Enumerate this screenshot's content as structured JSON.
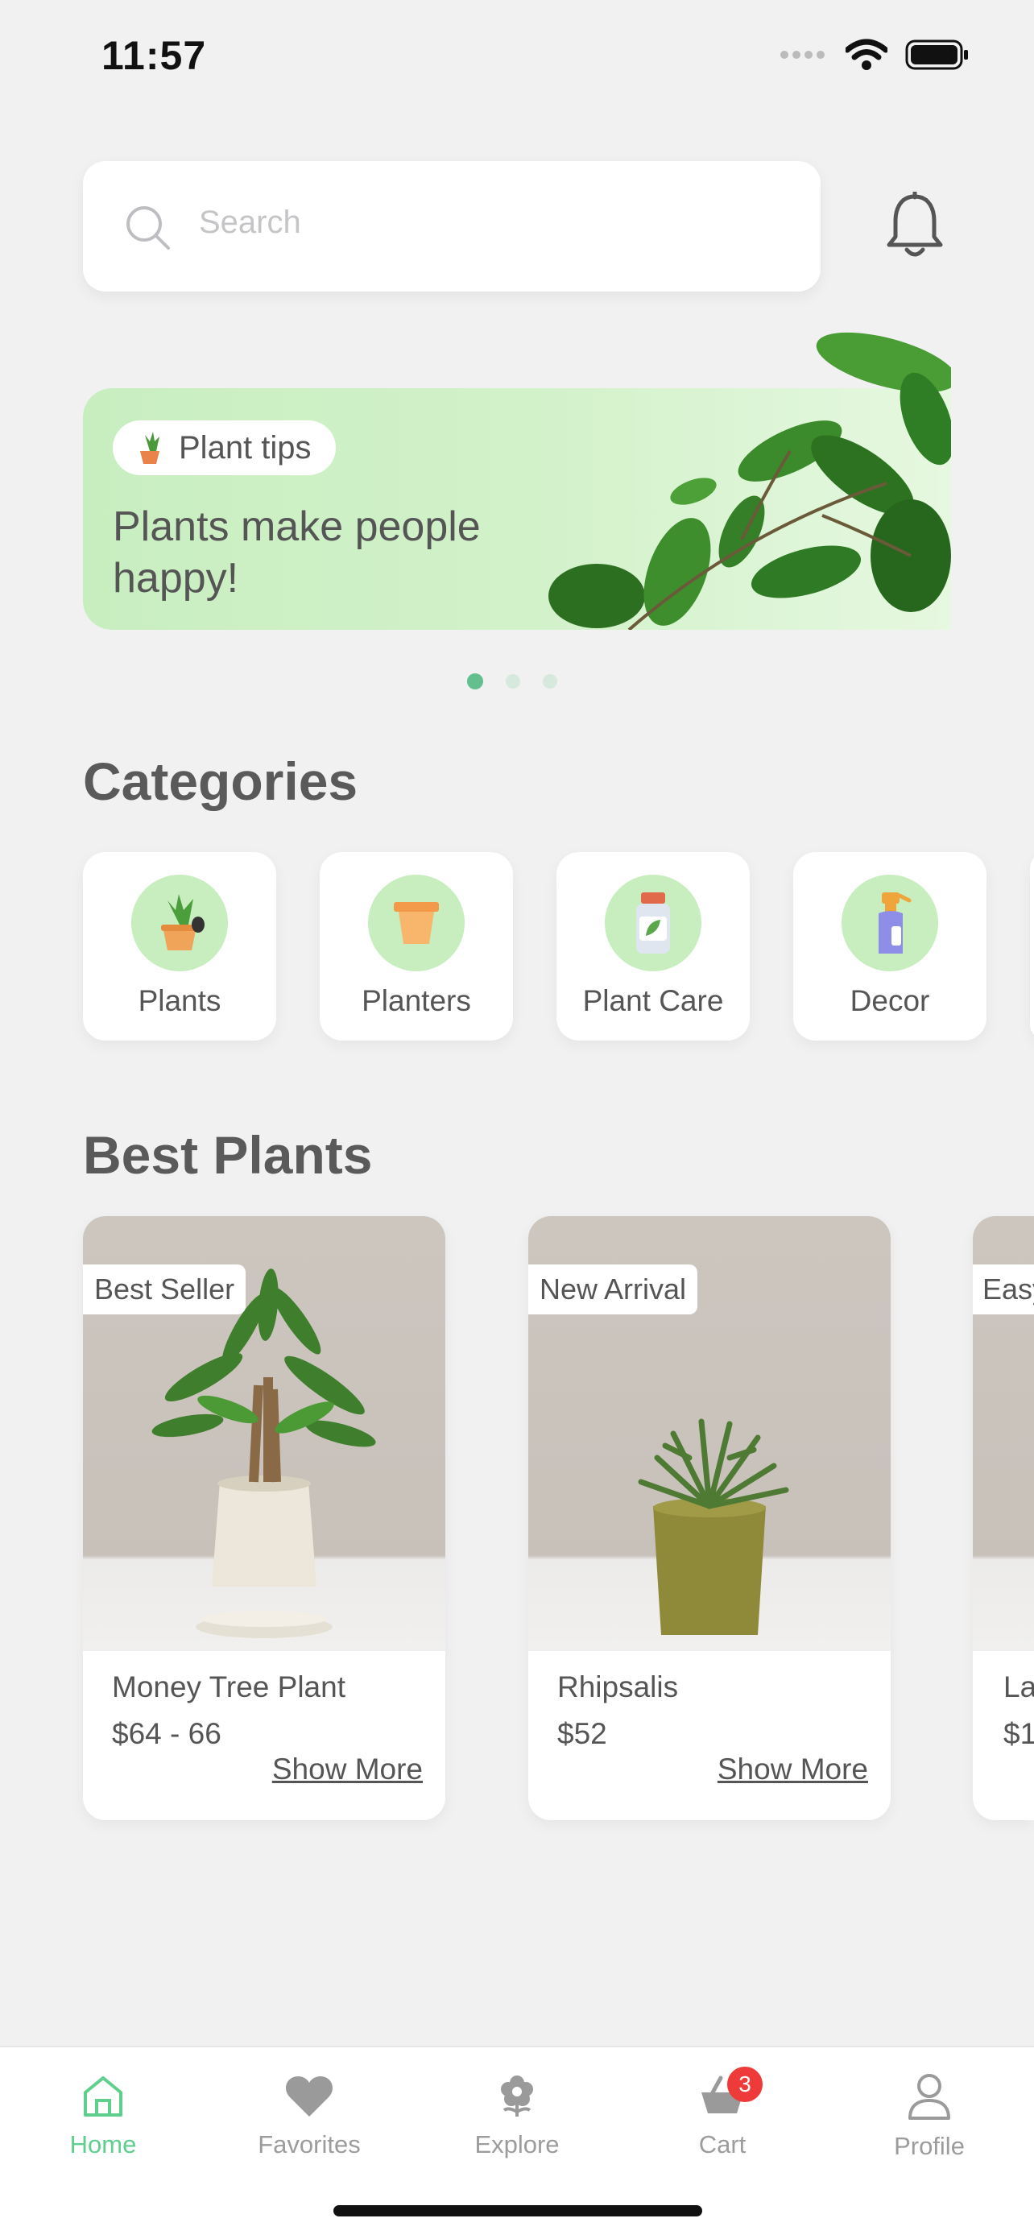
{
  "status_bar": {
    "time": "11:57"
  },
  "search": {
    "placeholder": "Search"
  },
  "banner": {
    "pill_label": "Plant tips",
    "headline": "Plants make people happy!",
    "active_dot": 0,
    "dot_count": 3
  },
  "categories": {
    "title": "Categories",
    "items": [
      {
        "label": "Plants",
        "icon": "potted-plant-icon"
      },
      {
        "label": "Planters",
        "icon": "planter-icon"
      },
      {
        "label": "Plant Care",
        "icon": "fertilizer-bottle-icon"
      },
      {
        "label": "Decor",
        "icon": "spray-bottle-icon"
      }
    ]
  },
  "best_plants": {
    "title": "Best Plants",
    "items": [
      {
        "badge": "Best Seller",
        "name": "Money Tree Plant",
        "price": "$64 - 66",
        "link": "Show More"
      },
      {
        "badge": "New Arrival",
        "name": "Rhipsalis",
        "price": "$52",
        "link": "Show More"
      },
      {
        "badge": "Easy",
        "name": "La",
        "price": "$1"
      }
    ]
  },
  "tabs": [
    {
      "label": "Home",
      "icon": "home-icon",
      "active": true
    },
    {
      "label": "Favorites",
      "icon": "heart-icon"
    },
    {
      "label": "Explore",
      "icon": "flower-icon"
    },
    {
      "label": "Cart",
      "icon": "cart-icon",
      "badge": "3"
    },
    {
      "label": "Profile",
      "icon": "user-icon"
    }
  ],
  "colors": {
    "accent": "#5fcf8e",
    "banner_green": "#c8eec0",
    "badge_red": "#ef3a3a",
    "background": "#f1f1f2"
  }
}
